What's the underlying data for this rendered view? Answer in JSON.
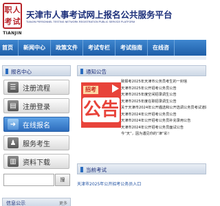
{
  "header": {
    "logo_chars": [
      "职",
      "人",
      "考",
      "试"
    ],
    "logo_caption": "TIANJIN",
    "title": "天津市人事考试网上报名公共服务平台",
    "subtitle": "TIANJIN PERSONNEL TESTING NETWORK REGISTRATION PUBLIC SERVICE PLATFORM"
  },
  "nav": {
    "items": [
      "首页",
      "新闻中心",
      "政策文件",
      "考试专栏",
      "考试指南",
      "在线咨"
    ]
  },
  "sidebar": {
    "title": "报名中心",
    "menu": [
      {
        "label": "注册流程",
        "icon": "list-icon",
        "active": false
      },
      {
        "label": "注册登录",
        "icon": "login-icon",
        "active": false
      },
      {
        "label": "在线报名",
        "icon": "arrow-icon",
        "active": true
      },
      {
        "label": "服务考生",
        "icon": "user-icon",
        "active": false
      },
      {
        "label": "资料下载",
        "icon": "download-icon",
        "active": false
      }
    ],
    "search_value": "",
    "search_button": "搜",
    "info_title": "信息公示",
    "info_more": "更多"
  },
  "notice": {
    "title": "通知公告",
    "image_ticket": "招考",
    "image_text": "公告",
    "items": [
      "致报考2025年天津市公务员考生的一封信",
      "天津市2025年公开招考公务员公告",
      "天津市2025年度空间招录调生公告",
      "天津市2025年度在职招录调生公告",
      "关于天津市2024年公开遴选和公开选调公务员考试道题",
      "天津市2024年公开招考公务员公告",
      "天津市2024年公开招考公务员补充录用公告",
      "天津市2024年公开招考公务员面试公告",
      "今“天”，因为遇见你的“津”彩！"
    ]
  },
  "exams": {
    "title": "当前考试",
    "link": "天津市2025年公开招考公务员入口"
  },
  "colors": {
    "brand_blue": "#1c2f7a",
    "nav_blue": "#1e5ea8",
    "seal_red": "#b8242a",
    "notice_red": "#e8433a"
  }
}
